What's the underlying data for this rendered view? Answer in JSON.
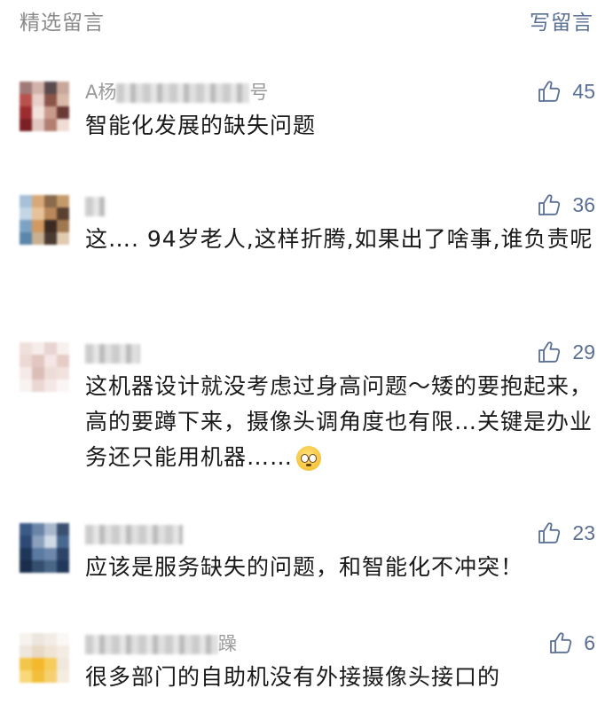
{
  "header": {
    "title": "精选留言",
    "write_label": "写留言"
  },
  "comments": [
    {
      "nickname": "A杨…号",
      "nickname_visible_start": "A杨",
      "nickname_visible_end": "号",
      "likes": "45",
      "text": "智能化发展的缺失问题"
    },
    {
      "nickname": "",
      "likes": "36",
      "text": "这…. 94岁老人,这样折腾,如果出了啥事,谁负责呢"
    },
    {
      "nickname": "",
      "likes": "29",
      "text": "这机器设计就没考虑过身高问题～矮的要抱起来，高的要蹲下来，摄像头调角度也有限…关键是办业务还只能用机器……"
    },
    {
      "nickname": "",
      "likes": "23",
      "text": "应该是服务缺失的问题，和智能化不冲突！"
    },
    {
      "nickname": "…躁",
      "nickname_visible_end": "躁",
      "likes": "6",
      "text": "很多部门的自助机没有外接摄像头接口的"
    }
  ],
  "icons": {
    "like": "thumbs-up-icon",
    "emoji": "pleading-face-emoji"
  },
  "colors": {
    "accent": "#5a6f94",
    "header_text": "#8a8a8a",
    "body_text": "#1a1a1a"
  }
}
